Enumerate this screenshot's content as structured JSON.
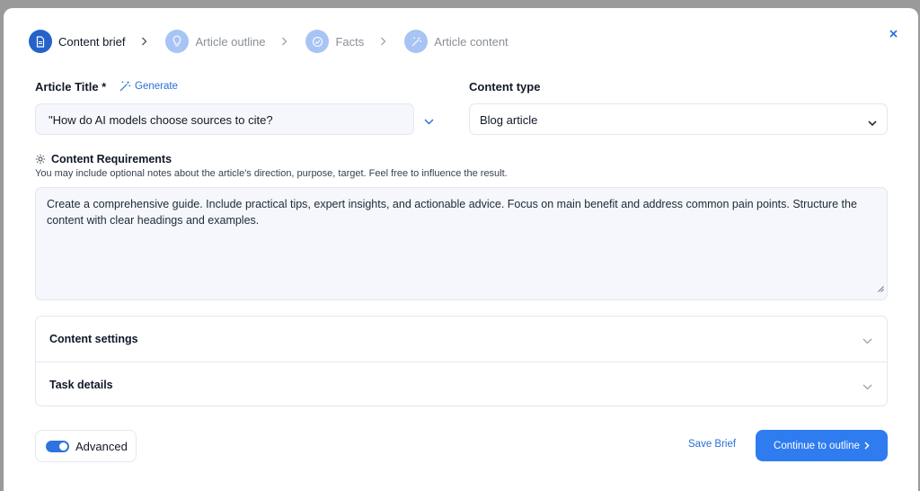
{
  "stepper": {
    "steps": [
      {
        "label": "Content brief",
        "icon": "document-icon",
        "state": "active"
      },
      {
        "label": "Article outline",
        "icon": "lightbulb-icon",
        "state": "inactive"
      },
      {
        "label": "Facts",
        "icon": "check-circle-icon",
        "state": "inactive"
      },
      {
        "label": "Article content",
        "icon": "magic-wand-icon",
        "state": "inactive"
      }
    ]
  },
  "form": {
    "title_label": "Article Title *",
    "generate_label": "Generate",
    "title_value": "\"How do AI models choose sources to cite?",
    "content_type_label": "Content type",
    "content_type_value": "Blog article",
    "requirements_label": "Content Requirements",
    "requirements_note": "You may include optional notes about the article's direction, purpose, target. Feel free to influence the result.",
    "requirements_value": "Create a comprehensive guide. Include practical tips, expert insights, and actionable advice. Focus on main benefit and address common pain points. Structure the content with clear headings and examples."
  },
  "accordion": {
    "content_settings": "Content settings",
    "task_details": "Task details"
  },
  "footer": {
    "advanced_label": "Advanced",
    "advanced_on": true,
    "save_brief": "Save Brief",
    "continue_label": "Continue to outline"
  },
  "colors": {
    "primary": "#2f7cf0",
    "step_active": "#2563c9",
    "step_inactive": "#a7c4f5"
  }
}
